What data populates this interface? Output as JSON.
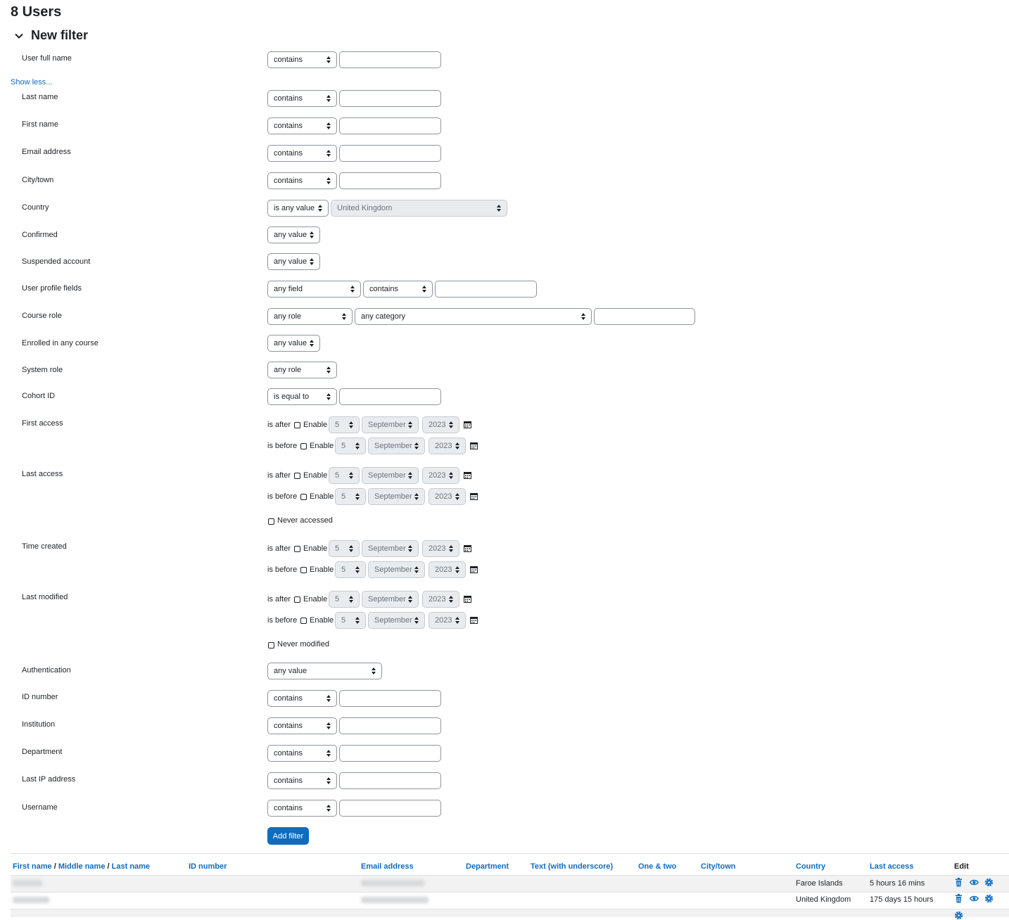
{
  "page_title": "8 Users",
  "section_title": "New filter",
  "show_less": "Show less...",
  "labels": {
    "user_full_name": "User full name",
    "last_name": "Last name",
    "first_name": "First name",
    "email": "Email address",
    "city": "City/town",
    "country": "Country",
    "confirmed": "Confirmed",
    "suspended": "Suspended account",
    "profile_fields": "User profile fields",
    "course_role": "Course role",
    "enrolled": "Enrolled in any course",
    "system_role": "System role",
    "cohort": "Cohort ID",
    "first_access": "First access",
    "last_access": "Last access",
    "time_created": "Time created",
    "last_modified": "Last modified",
    "authentication": "Authentication",
    "id_number": "ID number",
    "institution": "Institution",
    "department": "Department",
    "last_ip": "Last IP address",
    "username": "Username"
  },
  "ops": {
    "contains": "contains",
    "is_any_value": "is any value",
    "any_value": "any value",
    "any_field": "any field",
    "any_role": "any role",
    "any_category": "any category",
    "is_equal_to": "is equal to",
    "country_value": "United Kingdom"
  },
  "date": {
    "is_after": "is after",
    "is_before": "is before",
    "enable": "Enable",
    "day": "5",
    "month": "September",
    "year": "2023",
    "never_accessed": "Never accessed",
    "never_modified": "Never modified"
  },
  "add_filter": "Add filter",
  "table": {
    "headers": {
      "first_name": "First name",
      "slash": "/",
      "middle_name": "Middle name",
      "last_name": "Last name",
      "id_number": "ID number",
      "email": "Email address",
      "department": "Department",
      "text_underscore": "Text (with underscore)",
      "one_two": "One & two",
      "city": "City/town",
      "country": "Country",
      "last_access": "Last access",
      "edit": "Edit"
    },
    "rows": [
      {
        "country": "Faroe Islands",
        "last_access": "5 hours 16 mins"
      },
      {
        "country": "United Kingdom",
        "last_access": "175 days 15 hours"
      }
    ]
  },
  "colors": {
    "accent": "#0f6cbf",
    "text": "#1d2125",
    "border": "#8f959e"
  }
}
